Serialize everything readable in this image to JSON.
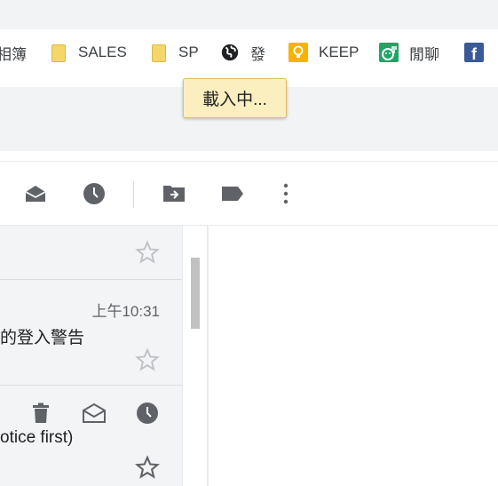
{
  "bookmarks_bar": {
    "items": [
      {
        "label": "相簿",
        "icon": "folder-icon"
      },
      {
        "label": "SALES",
        "icon": "folder-icon"
      },
      {
        "label": "SP",
        "icon": "folder-icon"
      },
      {
        "label": "發",
        "icon": "globe-icon"
      },
      {
        "label": "KEEP",
        "icon": "keep-icon"
      },
      {
        "label": "閒聊",
        "icon": "chat-icon"
      },
      {
        "label": "",
        "icon": "facebook-icon"
      }
    ]
  },
  "tooltip": {
    "text": "載入中..."
  },
  "toolbar": {
    "icons": [
      "mark-as-read-icon",
      "snooze-icon",
      "move-to-icon",
      "label-icon",
      "more-options-icon"
    ]
  },
  "mail_list": {
    "rows": [
      {
        "subject": "",
        "time": "",
        "starred": false
      },
      {
        "subject": "的登入警告",
        "time": "上午10:31",
        "starred": false
      },
      {
        "subject": "otice first)",
        "time": "",
        "starred": false,
        "hover_actions": [
          "delete-icon",
          "mark-as-unread-icon",
          "snooze-icon"
        ]
      }
    ]
  },
  "colors": {
    "chrome_bg": "#f1f3f4",
    "tooltip_bg": "#fbefbf",
    "list_bg": "#f2f4f5",
    "icon_gray": "#5f6368",
    "keep_yellow": "#f5b400",
    "chat_green": "#21a366",
    "facebook_blue": "#3b5998"
  }
}
